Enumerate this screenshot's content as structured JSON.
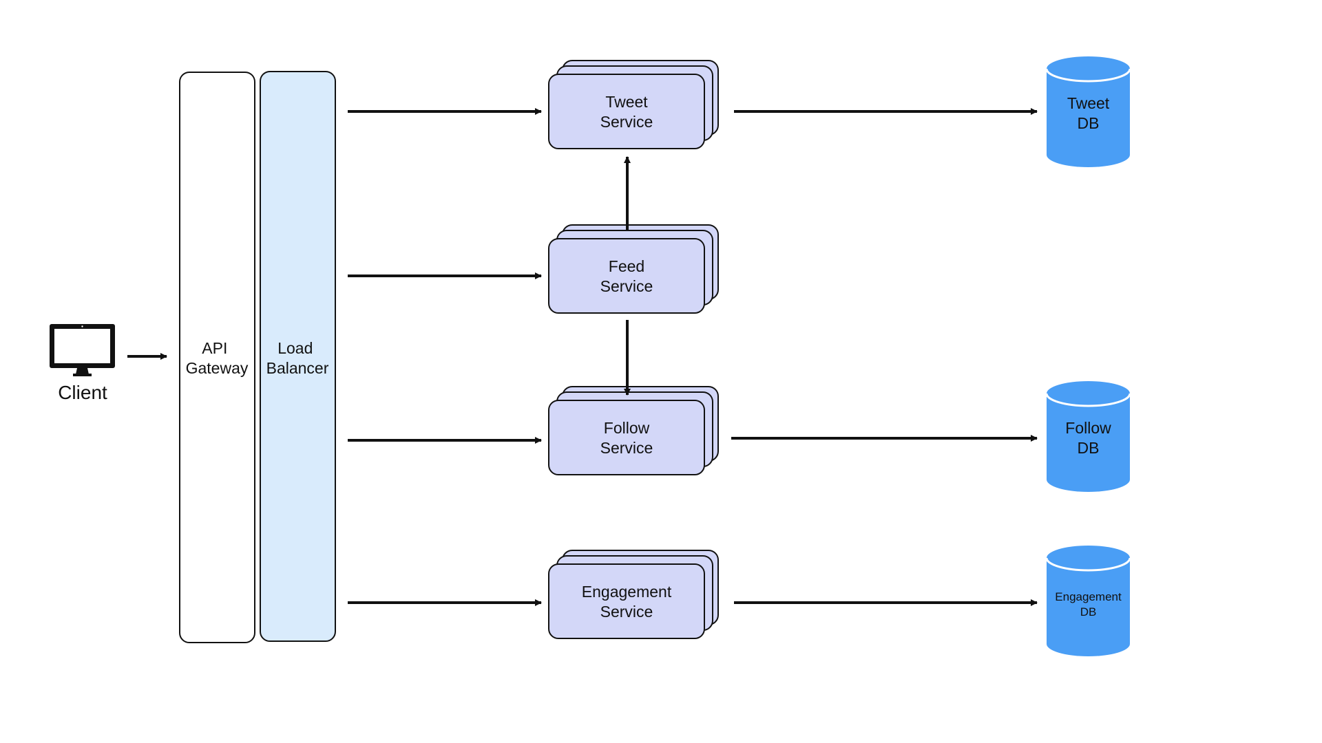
{
  "diagram": {
    "client": {
      "label": "Client",
      "icon": "desktop-monitor-icon"
    },
    "api_gateway": {
      "lines": [
        "API",
        "Gateway"
      ]
    },
    "load_balancer": {
      "lines": [
        "Load",
        "Balancer"
      ]
    },
    "services": [
      {
        "id": "tweet",
        "lines": [
          "Tweet",
          "Service"
        ]
      },
      {
        "id": "feed",
        "lines": [
          "Feed",
          "Service"
        ]
      },
      {
        "id": "follow",
        "lines": [
          "Follow",
          "Service"
        ]
      },
      {
        "id": "engagement",
        "lines": [
          "Engagement",
          "Service"
        ]
      }
    ],
    "databases": [
      {
        "id": "tweet-db",
        "lines": [
          "Tweet",
          "DB"
        ]
      },
      {
        "id": "follow-db",
        "lines": [
          "Follow",
          "DB"
        ]
      },
      {
        "id": "engagement-db",
        "lines": [
          "Engagement",
          "DB"
        ]
      }
    ],
    "edges": [
      {
        "from": "client",
        "to": "api-gateway"
      },
      {
        "from": "load-balancer",
        "to": "tweet-service"
      },
      {
        "from": "load-balancer",
        "to": "feed-service"
      },
      {
        "from": "load-balancer",
        "to": "follow-service"
      },
      {
        "from": "load-balancer",
        "to": "engagement-service"
      },
      {
        "from": "feed-service",
        "to": "tweet-service"
      },
      {
        "from": "feed-service",
        "to": "follow-service"
      },
      {
        "from": "tweet-service",
        "to": "tweet-db"
      },
      {
        "from": "follow-service",
        "to": "follow-db"
      },
      {
        "from": "engagement-service",
        "to": "engagement-db"
      }
    ],
    "colors": {
      "service_fill": "#d3d7f8",
      "load_balancer_fill": "#d9ebfc",
      "gateway_fill": "#ffffff",
      "database_fill": "#4a9ef5",
      "stroke": "#111111"
    }
  }
}
